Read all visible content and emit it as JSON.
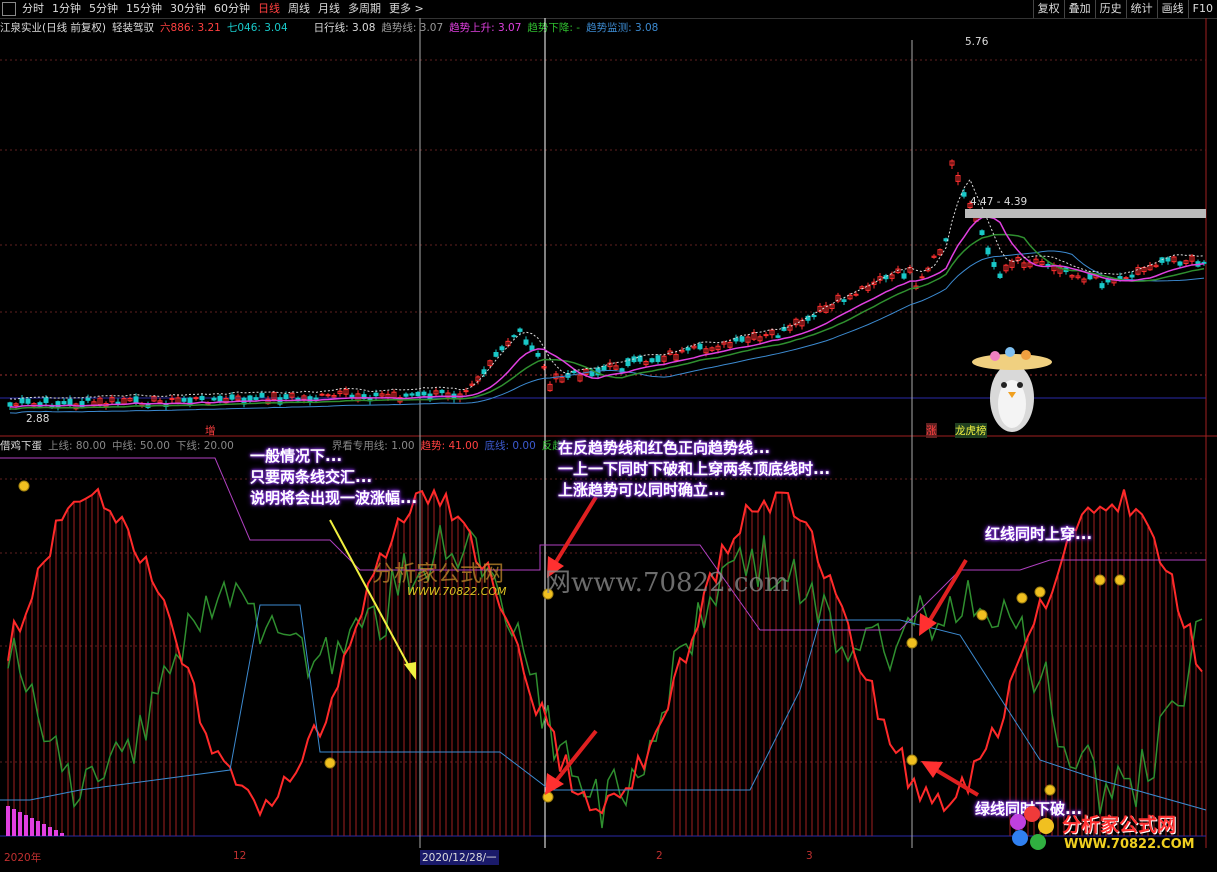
{
  "toolbar": {
    "periods": [
      "分时",
      "1分钟",
      "5分钟",
      "15分钟",
      "30分钟",
      "60分钟",
      "日线",
      "周线",
      "月线",
      "多周期",
      "更多 >"
    ],
    "active_period": "日线",
    "right_buttons": [
      "复权",
      "叠加",
      "历史",
      "统计",
      "画线",
      "F10"
    ]
  },
  "main_legend": {
    "stock": "江泉实业(日线 前复权)",
    "indicator": "轻装驾驭",
    "ma6": "六886: 3.21",
    "ma7": "七046: 3.04",
    "day_line": "日行线: 3.08",
    "trend_line": "趋势线: 3.07",
    "trend_up": "趋势上升: 3.07",
    "trend_down": "趋势下降: -",
    "trend_monitor": "趋势监测: 3.08"
  },
  "price_labels": {
    "high": "5.76",
    "low": "2.88",
    "range": "4.47 - 4.39"
  },
  "signal_tags": {
    "zeng": "增",
    "zhang": "涨",
    "bang": "龙虎榜"
  },
  "sub_legend": {
    "name": "借鸡下蛋",
    "upper": "上线: 80.00",
    "mid": "中线: 50.00",
    "lower": "下线: 20.00",
    "hidden": "界看专用线: 1.00",
    "trend": "趋势: 41.00",
    "bottom": "底线: 0.00",
    "reverse": "反趋"
  },
  "annotations": {
    "left": [
      "一般情况下...",
      "只要两条线交汇...",
      "说明将会出现一波涨幅..."
    ],
    "middle": [
      "在反趋势线和红色正向趋势线...",
      "一上一下同时下破和上穿两条顶底线时...",
      "上涨趋势可以同时确立..."
    ],
    "red_cross": "红线同时上穿...",
    "green_cross": "绿线同时下破..."
  },
  "watermarks": {
    "url_mid": "网www.70822.com",
    "brand_mid": "分析家公式网",
    "url_small": "WWW.70822.COM",
    "brand_logo": "分析家公式网",
    "url_logo": "WWW.70822.COM"
  },
  "xaxis": {
    "labels": [
      "2020年",
      "12",
      "2020/12/28/一",
      "2",
      "3"
    ]
  },
  "colors": {
    "up": "#ff3030",
    "down": "#19c8c8",
    "magenta": "#e040e0",
    "green": "#2f8f2f",
    "blue": "#3c5ad0",
    "annotation_glow": "#7a2bd6"
  }
}
